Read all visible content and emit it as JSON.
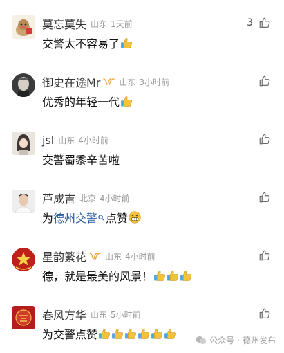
{
  "comments": [
    {
      "name": "莫忘莫失",
      "verified": false,
      "location": "山东",
      "time": "1天前",
      "likes": "3",
      "text": "交警太不容易了",
      "emojis": [
        "thumbs-up"
      ]
    },
    {
      "name": "御史在途Mr",
      "verified": true,
      "location": "山东",
      "time": "3小时前",
      "likes": "",
      "text": "优秀的年轻一代",
      "emojis": [
        "thumbs-up"
      ]
    },
    {
      "name": "jsl",
      "verified": false,
      "location": "山东",
      "time": "4小时前",
      "likes": "",
      "text": "交警蜀黍辛苦啦",
      "emojis": []
    },
    {
      "name": "芦成吉",
      "verified": false,
      "location": "北京",
      "time": "4小时前",
      "likes": "",
      "text_prefix": "为",
      "text_link": "德州交警",
      "text_suffix": "点赞",
      "emojis": [
        "grin"
      ]
    },
    {
      "name": "星韵繁花",
      "verified": true,
      "location": "山东",
      "time": "4小时前",
      "likes": "",
      "text": "德，就是最美的风景！",
      "emojis": [
        "thumbs-up",
        "thumbs-up",
        "thumbs-up"
      ]
    },
    {
      "name": "春风方华",
      "verified": false,
      "location": "山东",
      "time": "5小时前",
      "likes": "",
      "text": "为交警点赞",
      "emojis": [
        "thumbs-up",
        "thumbs-up",
        "thumbs-up",
        "thumbs-up",
        "thumbs-up",
        "thumbs-up"
      ]
    }
  ],
  "watermark": {
    "platform": "公众号",
    "separator": "·",
    "account": "德州发布"
  },
  "icons": {
    "like": "thumbs-up-outline-icon",
    "verified": "wechat-v-badge-icon",
    "watermark": "wechat-logo-icon"
  },
  "colors": {
    "link": "#2a5c9a",
    "meta": "#9a9a9a",
    "emoji_yellow": "#f5c33b",
    "verified_badge": "#f0a53a"
  }
}
